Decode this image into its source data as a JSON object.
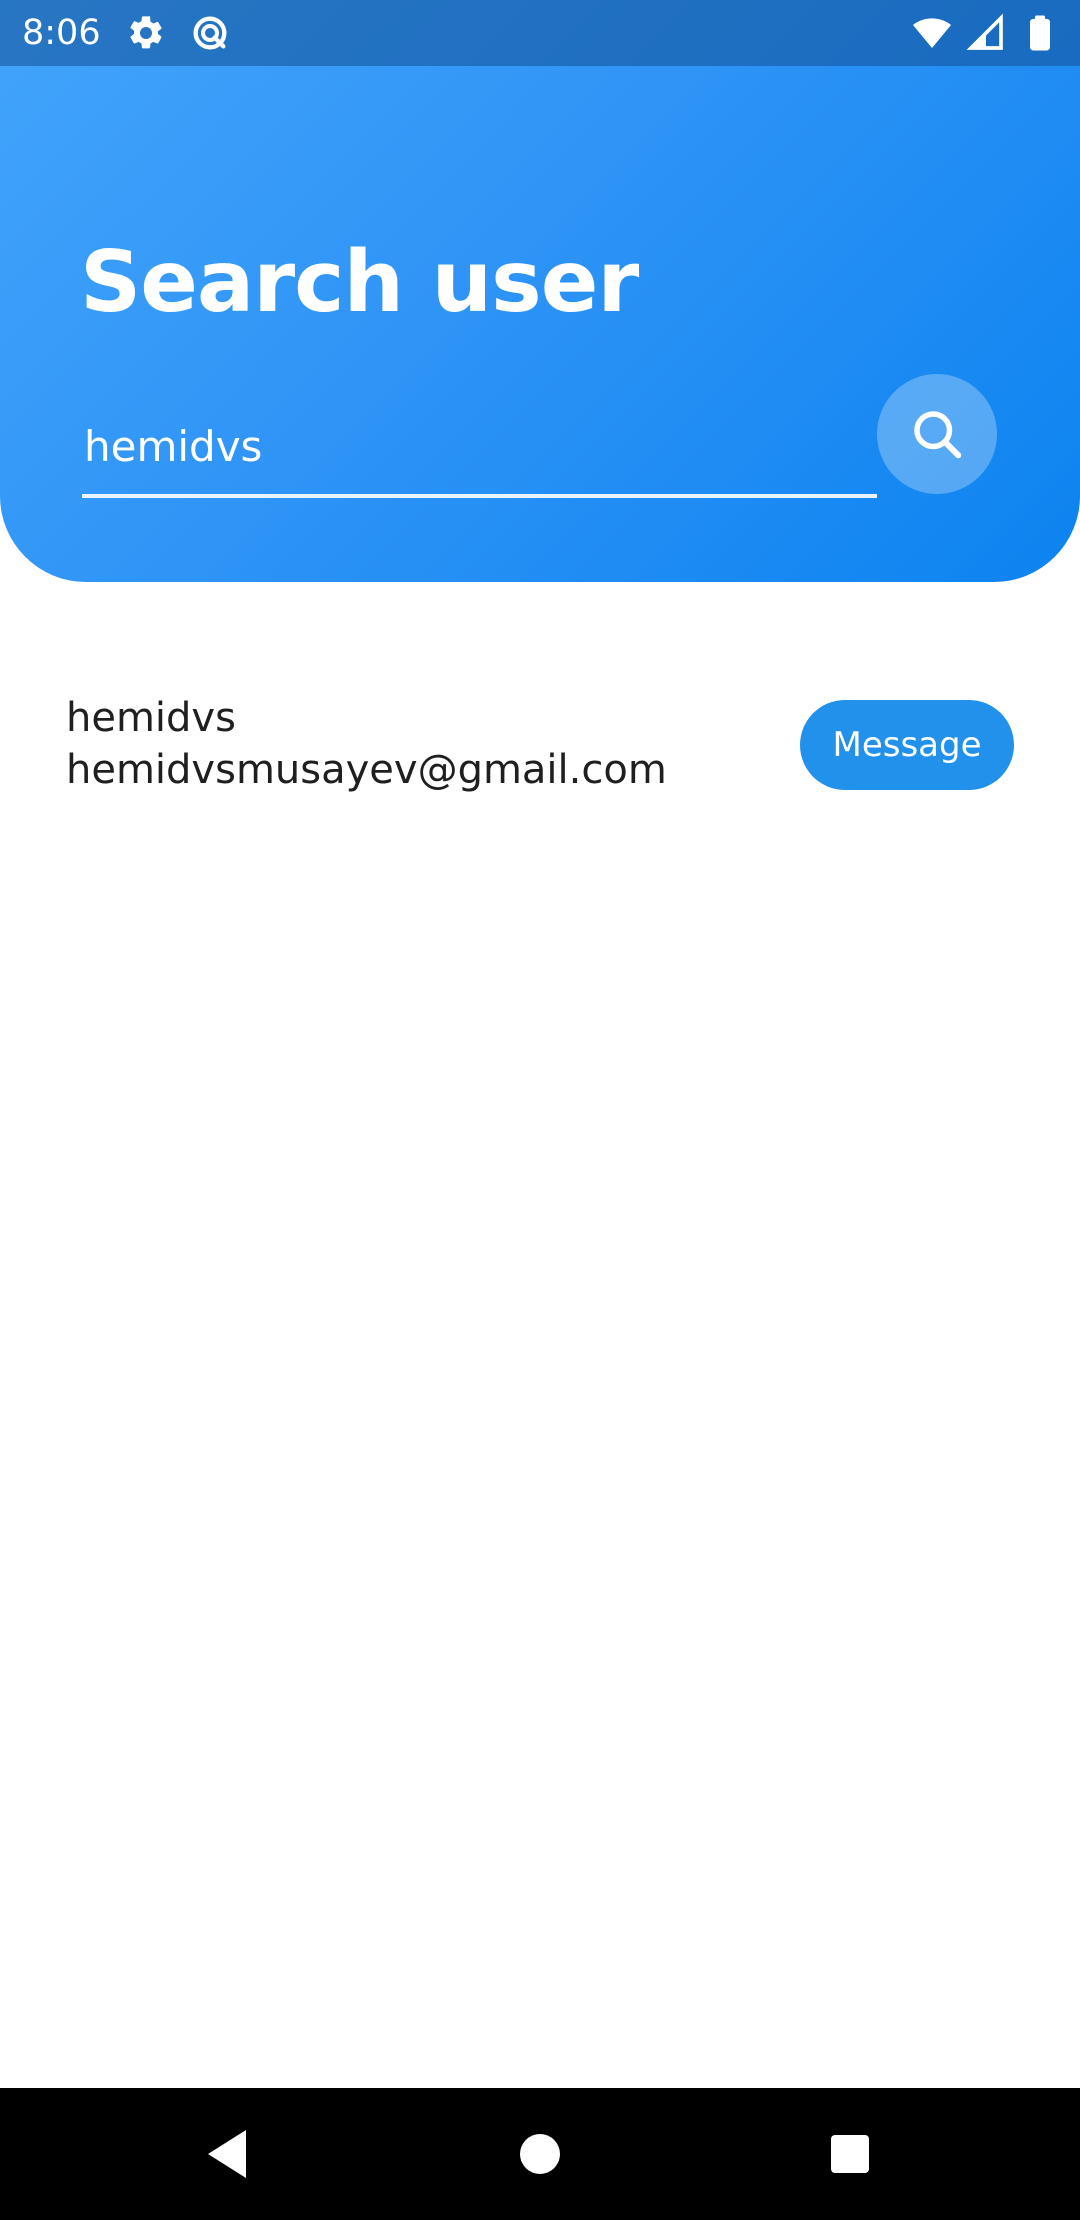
{
  "status_bar": {
    "time": "8:06",
    "left_icons": [
      "settings-icon",
      "data-saver-icon"
    ],
    "right_icons": [
      "wifi-icon",
      "cell-signal-icon",
      "battery-icon"
    ]
  },
  "header": {
    "title": "Search user",
    "gradient_start": "#42a4fb",
    "gradient_end": "#0c83f0"
  },
  "search": {
    "value": "hemidvs",
    "button_icon": "search-icon"
  },
  "results": [
    {
      "name": "hemidvs",
      "email": "hemidvsmusayev@gmail.com",
      "action_label": "Message"
    }
  ],
  "nav_bar": {
    "icons": [
      "back-icon",
      "home-icon",
      "recents-icon"
    ]
  },
  "colors": {
    "accent": "#2191ec",
    "text_primary": "#1f1f1f"
  }
}
